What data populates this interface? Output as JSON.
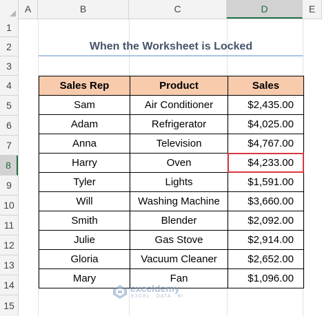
{
  "columns": [
    "A",
    "B",
    "C",
    "D",
    "E"
  ],
  "selected_column": "D",
  "rows": [
    "1",
    "2",
    "3",
    "4",
    "5",
    "6",
    "7",
    "8",
    "9",
    "10",
    "11",
    "12",
    "13",
    "14",
    "15"
  ],
  "selected_row": "8",
  "title": "When the Worksheet is Locked",
  "table": {
    "headers": [
      "Sales Rep",
      "Product",
      "Sales"
    ],
    "rows": [
      [
        "Sam",
        "Air Conditioner",
        "$2,435.00"
      ],
      [
        "Adam",
        "Refrigerator",
        "$4,025.00"
      ],
      [
        "Anna",
        "Television",
        "$4,767.00"
      ],
      [
        "Harry",
        "Oven",
        "$4,233.00"
      ],
      [
        "Tyler",
        "Lights",
        "$1,591.00"
      ],
      [
        "Will",
        "Washing Machine",
        "$3,660.00"
      ],
      [
        "Smith",
        "Blender",
        "$2,092.00"
      ],
      [
        "Julie",
        "Gas Stove",
        "$2,914.00"
      ],
      [
        "Gloria",
        "Vacuum Cleaner",
        "$2,652.00"
      ],
      [
        "Mary",
        "Fan",
        "$1,096.00"
      ]
    ]
  },
  "active_cell": "D8",
  "watermark": {
    "name": "exceldemy",
    "sub": "EXCEL · DATA · BI"
  },
  "colors": {
    "header_fill": "#f8cbad",
    "title_text": "#44546a",
    "active_border": "#d9373f",
    "selected_header": "#217346"
  }
}
